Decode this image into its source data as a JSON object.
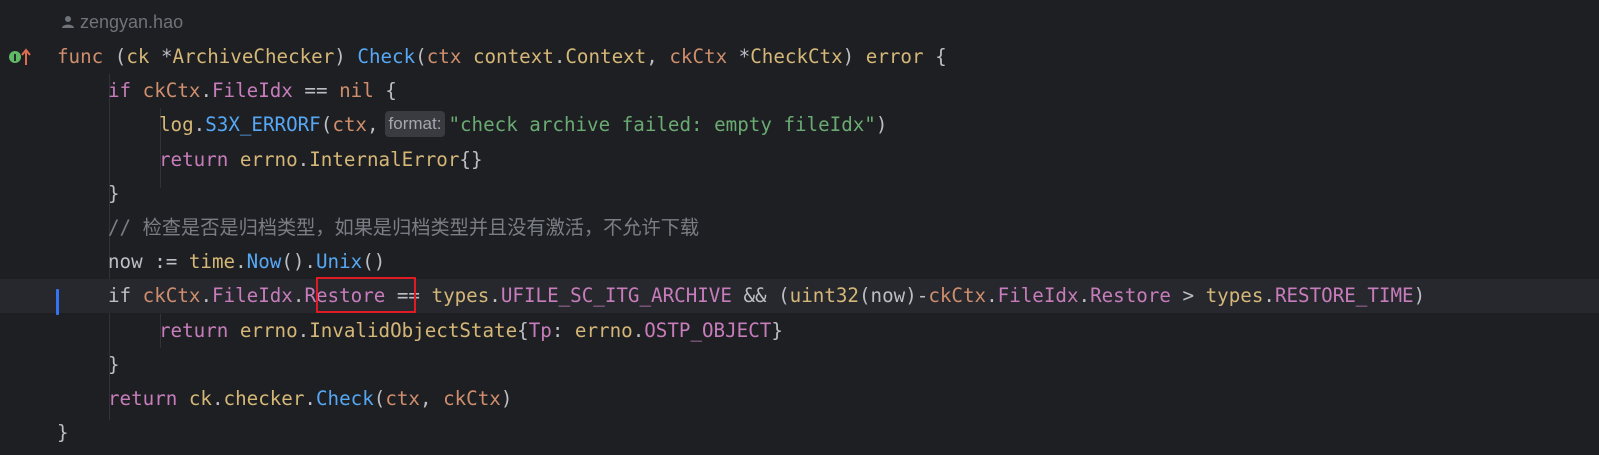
{
  "editor": {
    "author": "zengyan.hao",
    "lines": [
      {
        "indent": 0,
        "tokens": [
          {
            "t": "func",
            "c": "kw"
          },
          {
            "t": " (",
            "c": "par"
          },
          {
            "t": "ck",
            "c": "ty"
          },
          {
            "t": " *",
            "c": "par"
          },
          {
            "t": "ArchiveChecker",
            "c": "ty"
          },
          {
            "t": ") ",
            "c": "par"
          },
          {
            "t": "Check",
            "c": "fn"
          },
          {
            "t": "(",
            "c": "par"
          },
          {
            "t": "ctx",
            "c": "kw"
          },
          {
            "t": " ",
            "c": "par"
          },
          {
            "t": "context",
            "c": "ty"
          },
          {
            "t": ".",
            "c": "par"
          },
          {
            "t": "Context",
            "c": "ty"
          },
          {
            "t": ", ",
            "c": "par"
          },
          {
            "t": "ckCtx",
            "c": "kw"
          },
          {
            "t": " *",
            "c": "par"
          },
          {
            "t": "CheckCtx",
            "c": "ty"
          },
          {
            "t": ") ",
            "c": "par"
          },
          {
            "t": "error",
            "c": "ty"
          },
          {
            "t": " {",
            "c": "par"
          }
        ]
      },
      {
        "indent": 1,
        "tokens": [
          {
            "t": "if",
            "c": "kw2"
          },
          {
            "t": " ",
            "c": "par"
          },
          {
            "t": "ckCtx",
            "c": "kw"
          },
          {
            "t": ".",
            "c": "par"
          },
          {
            "t": "FileIdx",
            "c": "fld"
          },
          {
            "t": " == ",
            "c": "par"
          },
          {
            "t": "nil",
            "c": "kw"
          },
          {
            "t": " {",
            "c": "par"
          }
        ]
      },
      {
        "indent": 2,
        "tokens": [
          {
            "t": "log",
            "c": "ty"
          },
          {
            "t": ".",
            "c": "par"
          },
          {
            "t": "S3X_ERRORF",
            "c": "fn"
          },
          {
            "t": "(",
            "c": "par"
          },
          {
            "t": "ctx",
            "c": "kw"
          },
          {
            "t": ",",
            "c": "par"
          },
          {
            "t": "format:",
            "c": "hint"
          },
          {
            "t": "\"check archive failed: empty fileIdx\"",
            "c": "str"
          },
          {
            "t": ")",
            "c": "par"
          }
        ]
      },
      {
        "indent": 2,
        "tokens": [
          {
            "t": "return",
            "c": "kw2"
          },
          {
            "t": " ",
            "c": "par"
          },
          {
            "t": "errno",
            "c": "ty"
          },
          {
            "t": ".",
            "c": "par"
          },
          {
            "t": "InternalError",
            "c": "ty"
          },
          {
            "t": "{}",
            "c": "par"
          }
        ]
      },
      {
        "indent": 1,
        "tokens": [
          {
            "t": "}",
            "c": "par"
          }
        ]
      },
      {
        "indent": 1,
        "tokens": [
          {
            "t": "// 检查是否是归档类型，如果是归档类型并且没有激活，不允许下载",
            "c": "cmt"
          }
        ]
      },
      {
        "indent": 1,
        "tokens": [
          {
            "t": "now",
            "c": "par"
          },
          {
            "t": " := ",
            "c": "par"
          },
          {
            "t": "time",
            "c": "ty"
          },
          {
            "t": ".",
            "c": "par"
          },
          {
            "t": "Now",
            "c": "fn"
          },
          {
            "t": "().",
            "c": "par"
          },
          {
            "t": "Unix",
            "c": "fn"
          },
          {
            "t": "()",
            "c": "par"
          }
        ]
      },
      {
        "indent": 1,
        "current": true,
        "tokens": [
          {
            "t": "if",
            "c": "par"
          },
          {
            "t": " ",
            "c": "par"
          },
          {
            "t": "ckCtx",
            "c": "kw"
          },
          {
            "t": ".",
            "c": "par"
          },
          {
            "t": "FileIdx",
            "c": "fld"
          },
          {
            "t": ".",
            "c": "par"
          },
          {
            "t": "Restore",
            "c": "fld"
          },
          {
            "t": " == ",
            "c": "par"
          },
          {
            "t": "types",
            "c": "ty"
          },
          {
            "t": ".",
            "c": "par"
          },
          {
            "t": "UFILE_SC_ITG_ARCHIVE",
            "c": "cst"
          },
          {
            "t": " && (",
            "c": "par"
          },
          {
            "t": "uint32",
            "c": "ty"
          },
          {
            "t": "(",
            "c": "par"
          },
          {
            "t": "now",
            "c": "par"
          },
          {
            "t": ")-",
            "c": "par"
          },
          {
            "t": "ckCtx",
            "c": "kw"
          },
          {
            "t": ".",
            "c": "par"
          },
          {
            "t": "FileIdx",
            "c": "fld"
          },
          {
            "t": ".",
            "c": "par"
          },
          {
            "t": "Restore",
            "c": "fld"
          },
          {
            "t": " > ",
            "c": "par"
          },
          {
            "t": "types",
            "c": "ty"
          },
          {
            "t": ".",
            "c": "par"
          },
          {
            "t": "RESTORE_TIME",
            "c": "cst"
          },
          {
            "t": ")",
            "c": "par"
          }
        ]
      },
      {
        "indent": 2,
        "tokens": [
          {
            "t": "return",
            "c": "kw2"
          },
          {
            "t": " ",
            "c": "par"
          },
          {
            "t": "errno",
            "c": "ty"
          },
          {
            "t": ".",
            "c": "par"
          },
          {
            "t": "InvalidObjectState",
            "c": "ty"
          },
          {
            "t": "{",
            "c": "par"
          },
          {
            "t": "Tp",
            "c": "fld"
          },
          {
            "t": ": ",
            "c": "par"
          },
          {
            "t": "errno",
            "c": "ty"
          },
          {
            "t": ".",
            "c": "par"
          },
          {
            "t": "OSTP_OBJECT",
            "c": "cst"
          },
          {
            "t": "}",
            "c": "par"
          }
        ]
      },
      {
        "indent": 1,
        "tokens": [
          {
            "t": "}",
            "c": "par"
          }
        ]
      },
      {
        "indent": 1,
        "tokens": [
          {
            "t": "return",
            "c": "kw2"
          },
          {
            "t": " ",
            "c": "par"
          },
          {
            "t": "ck",
            "c": "ty"
          },
          {
            "t": ".",
            "c": "par"
          },
          {
            "t": "checker",
            "c": "ty"
          },
          {
            "t": ".",
            "c": "par"
          },
          {
            "t": "Check",
            "c": "fn"
          },
          {
            "t": "(",
            "c": "par"
          },
          {
            "t": "ctx",
            "c": "kw"
          },
          {
            "t": ", ",
            "c": "par"
          },
          {
            "t": "ckCtx",
            "c": "kw"
          },
          {
            "t": ")",
            "c": "par"
          }
        ]
      },
      {
        "indent": 0,
        "tokens": [
          {
            "t": "}",
            "c": "par"
          }
        ]
      }
    ]
  },
  "gutter": {
    "icon": "implementation-up-arrow-icon",
    "icon_color": "#5fb865",
    "arrow_color": "#e06c4f"
  },
  "highlight": {
    "target": "Restore",
    "border_color": "#e01b24"
  }
}
